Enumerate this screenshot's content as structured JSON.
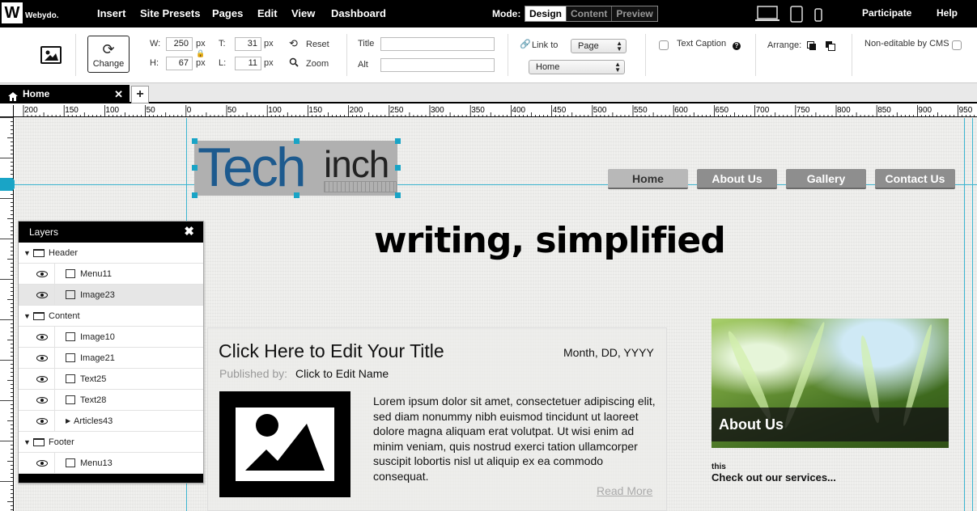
{
  "app": {
    "logo_letter": "W",
    "logo_name": "Webydo."
  },
  "topbar": {
    "menu": [
      "Insert",
      "Site Presets",
      "Pages",
      "Edit",
      "View",
      "Dashboard"
    ],
    "mode_label": "Mode:",
    "modes": [
      "Design",
      "Content",
      "Preview"
    ],
    "active_mode": "Design",
    "devices": [
      "desktop-icon",
      "tablet-icon",
      "mobile-icon"
    ],
    "right": [
      "Participate",
      "Help"
    ]
  },
  "toolbar": {
    "change_label": "Change",
    "w_label": "W:",
    "w_value": "250",
    "h_label": "H:",
    "h_value": "67",
    "t_label": "T:",
    "t_value": "31",
    "l_label": "L:",
    "l_value": "11",
    "unit": "px",
    "reset_label": "Reset",
    "zoom_label": "Zoom",
    "title_label": "Title",
    "title_value": "",
    "alt_label": "Alt",
    "alt_value": "",
    "link_label": "Link to",
    "link_type": "Page",
    "link_target": "Home",
    "caption_label": "Text Caption",
    "arrange_label": "Arrange:",
    "noncms_label": "Non-editable by CMS"
  },
  "tabs": {
    "home": "Home",
    "add": "+"
  },
  "ruler": {
    "h_labels": [
      "200",
      "150",
      "100",
      "50",
      "0",
      "50",
      "100",
      "150",
      "200",
      "250",
      "300",
      "350",
      "400",
      "450",
      "500",
      "550",
      "600",
      "650",
      "700",
      "750",
      "800",
      "850",
      "900",
      "950"
    ]
  },
  "site": {
    "logo_tech": "Tech",
    "logo_inch": "inch",
    "nav": [
      "Home",
      "About Us",
      "Gallery",
      "Contact Us"
    ],
    "nav_active": "Home",
    "headline": "writing, simplified",
    "article": {
      "title": "Click Here to Edit Your Title",
      "date": "Month, DD, YYYY",
      "published_by": "Published by:",
      "author": "Click to Edit Name",
      "body": "Lorem ipsum dolor sit amet, consectetuer adipiscing elit, sed diam nonummy nibh euismod tincidunt ut laoreet dolore magna aliquam erat volutpat. Ut wisi enim ad minim veniam, quis nostrud exerci tation ullamcorper suscipit lobortis nisl ut aliquip ex ea commodo consequat.",
      "read_more": "Read More"
    },
    "sidebar": {
      "photo_caption": "About Us",
      "small": "this",
      "sub": "Check out our services..."
    }
  },
  "layers": {
    "title": "Layers",
    "close": "✖",
    "groups": [
      {
        "name": "Header",
        "items": [
          {
            "name": "Menu11",
            "type": "menu"
          },
          {
            "name": "Image23",
            "type": "image",
            "selected": true
          }
        ]
      },
      {
        "name": "Content",
        "items": [
          {
            "name": "Image10",
            "type": "image"
          },
          {
            "name": "Image21",
            "type": "image"
          },
          {
            "name": "Text25",
            "type": "text"
          },
          {
            "name": "Text28",
            "type": "text"
          },
          {
            "name": "Articles43",
            "type": "articles"
          }
        ]
      },
      {
        "name": "Footer",
        "items": [
          {
            "name": "Menu13",
            "type": "menu"
          }
        ]
      }
    ]
  }
}
